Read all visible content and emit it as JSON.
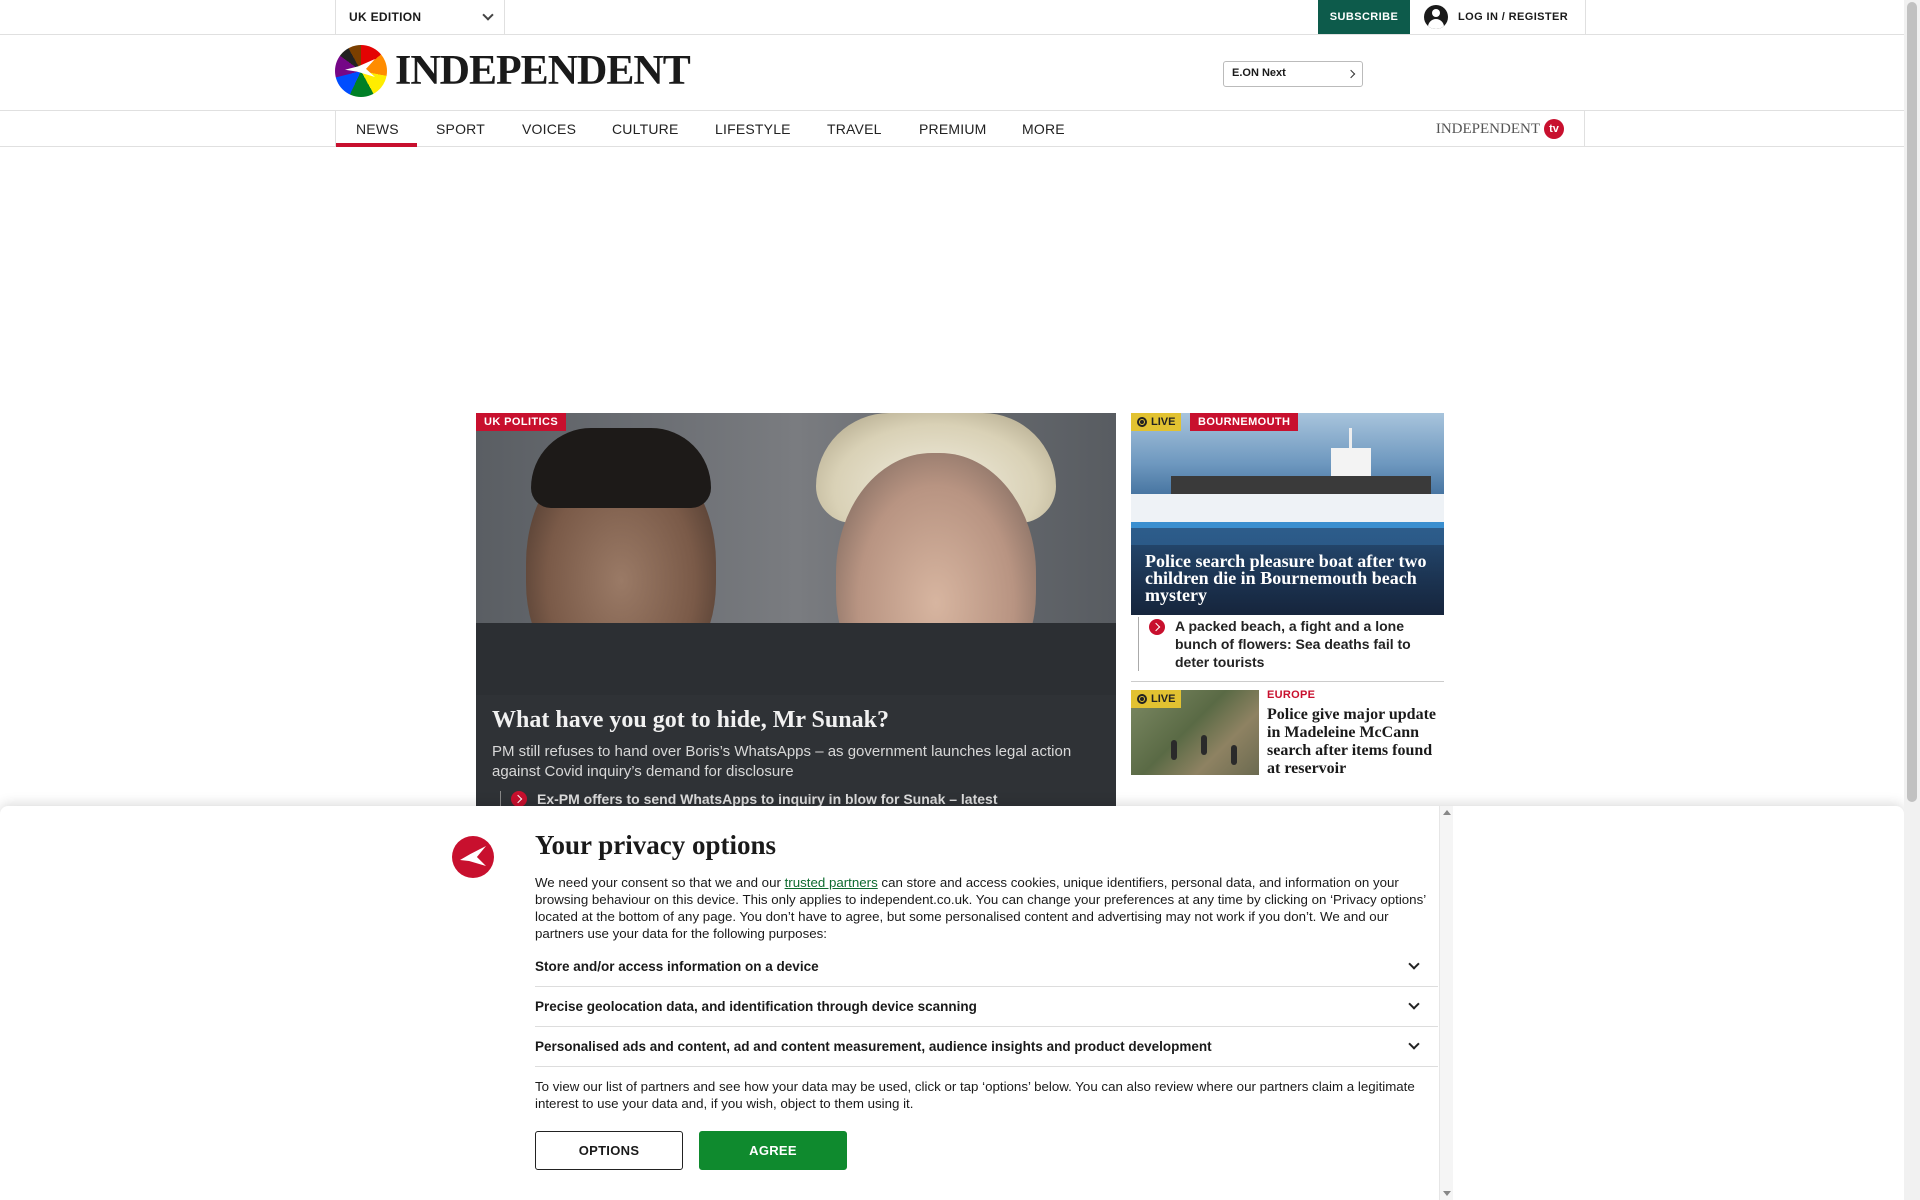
{
  "topbar": {
    "edition": "UK EDITION",
    "subscribe": "SUBSCRIBE",
    "login": "LOG IN / REGISTER"
  },
  "masthead": {
    "logo_text": "INDEPENDENT",
    "sponsor": "E.ON Next"
  },
  "nav": {
    "items": [
      "NEWS",
      "SPORT",
      "VOICES",
      "CULTURE",
      "LIFESTYLE",
      "TRAVEL",
      "PREMIUM",
      "MORE"
    ],
    "active": "NEWS",
    "tv_brand": "INDEPENDENT",
    "tv_badge": "tv"
  },
  "hero": {
    "tag": "UK POLITICS",
    "title": "What have you got to hide, Mr Sunak?",
    "subtitle": "PM still refuses to hand over Boris’s WhatsApps – as government launches legal action against Covid inquiry’s demand for disclosure",
    "related": "Ex-PM offers to send WhatsApps to inquiry in blow for Sunak – latest"
  },
  "side_story_1": {
    "live": "LIVE",
    "tag": "BOURNEMOUTH",
    "title": "Police search pleasure boat after two children die in Bournemouth beach mystery",
    "related": "A packed beach, a fight and a lone bunch of flowers: Sea deaths fail to deter tourists"
  },
  "side_story_2": {
    "live": "LIVE",
    "section": "EUROPE",
    "title": "Police give major update in Madeleine McCann search after items found at reservoir"
  },
  "privacy": {
    "title": "Your privacy options",
    "intro_before_link": "We need your consent so that we and our ",
    "intro_link": "trusted partners",
    "intro_after_link": " can store and access cookies, unique identifiers, personal data, and information on your browsing behaviour on this device. This only applies to independent.co.uk. You can change your preferences at any time by clicking on ‘Privacy options’ located at the bottom of any page. You don’t have to agree, but some personalised content and advertising may not work if you don’t. We and our partners use your data for the following purposes:",
    "purposes": [
      "Store and/or access information on a device",
      "Precise geolocation data, and identification through device scanning",
      "Personalised ads and content, ad and content measurement, audience insights and product development"
    ],
    "footer": "To view our list of partners and see how your data may be used, click or tap ‘options’ below. You can also review where our partners claim a legitimate interest to use your data and, if you wish, object to them using it.",
    "options_button": "OPTIONS",
    "agree_button": "AGREE"
  },
  "colors": {
    "accent_red": "#c8102e",
    "subscribe_green": "#0d5b4b",
    "agree_green": "#0f8a2e",
    "live_yellow": "#e2c231"
  },
  "icons": [
    "chevron-down-icon",
    "user-avatar-icon",
    "chevron-right-icon",
    "live-icon",
    "related-arrow-icon",
    "independent-eagle-icon"
  ]
}
